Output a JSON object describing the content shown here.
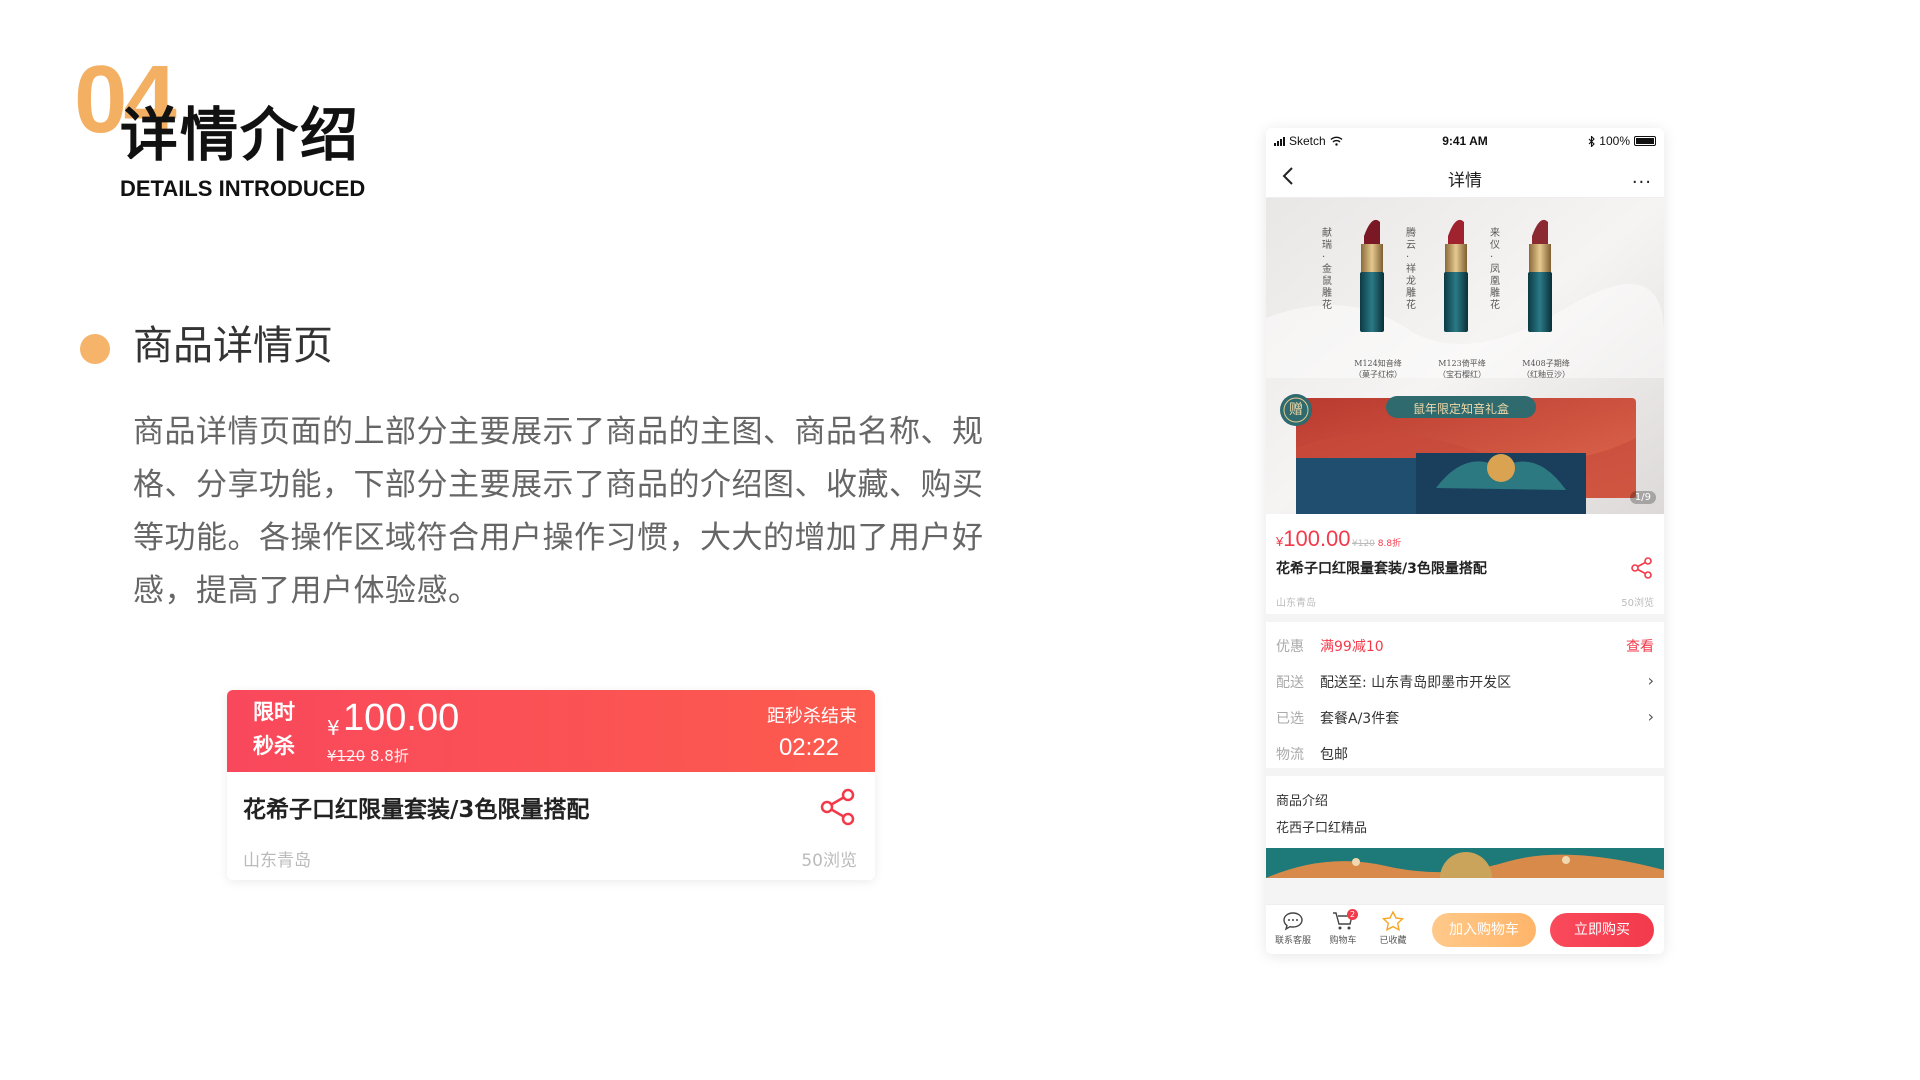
{
  "section": {
    "number": "04",
    "title": "详情介绍",
    "subtitle": "DETAILS INTRODUCED"
  },
  "heading": "商品详情页",
  "description": "商品详情页面的上部分主要展示了商品的主图、商品名称、规格、分享功能，下部分主要展示了商品的介绍图、收藏、购买等功能。各操作区域符合用户操作习惯，大大的增加了用户好感，提高了用户体验感。",
  "flash_card": {
    "tag_line1": "限时",
    "tag_line2": "秒杀",
    "currency": "¥",
    "price": "100.00",
    "original_price": "¥120",
    "discount": "8.8折",
    "countdown_label": "距秒杀结束",
    "countdown": "02:22",
    "name": "花希子口红限量套装/3色限量搭配",
    "location": "山东青岛",
    "views": "50浏览",
    "share_icon": "share-icon"
  },
  "phone": {
    "status": {
      "carrier": "Sketch",
      "time": "9:41 AM",
      "battery": "100%"
    },
    "nav": {
      "title": "详情",
      "more": "···"
    },
    "hero": {
      "lipsticks": [
        {
          "vertical_text": "献瑞·金鼠雕花",
          "caption_line1": "M124知音绛",
          "caption_line2": "（菓子红棕）"
        },
        {
          "vertical_text": "腾云·祥龙雕花",
          "caption_line1": "M123倚平绛",
          "caption_line2": "（宝石樱红）"
        },
        {
          "vertical_text": "来仪·凤凰雕花",
          "caption_line1": "M408子期绛",
          "caption_line2": "（红釉豆沙）"
        }
      ],
      "gift_badge": "赠",
      "gift_title": "鼠年限定知音礼盒",
      "counter": "1/9"
    },
    "info": {
      "currency": "¥",
      "price": "100.00",
      "original_price": "¥120",
      "discount": "8.8折",
      "name": "花希子口红限量套装/3色限量搭配",
      "location": "山东青岛",
      "views": "50浏览"
    },
    "rows": [
      {
        "key": "优惠",
        "value": "满99减10",
        "action": "查看"
      },
      {
        "key": "配送",
        "value": "配送至: 山东青岛即墨市开发区"
      },
      {
        "key": "已选",
        "value": "套餐A/3件套"
      },
      {
        "key": "物流",
        "value": "包邮"
      }
    ],
    "intro": {
      "title": "商品介绍",
      "subtitle": "花西子口红精品"
    },
    "tabbar": {
      "service": "联系客服",
      "cart": "购物车",
      "cart_badge": "2",
      "favorite": "已收藏",
      "add_to_cart": "加入购物车",
      "buy_now": "立即购买"
    }
  },
  "colors": {
    "accent_orange": "#F4B062",
    "sale_red": "#F9485C",
    "price_red": "#F23A4B",
    "cart_orange": "#FFB56A"
  }
}
